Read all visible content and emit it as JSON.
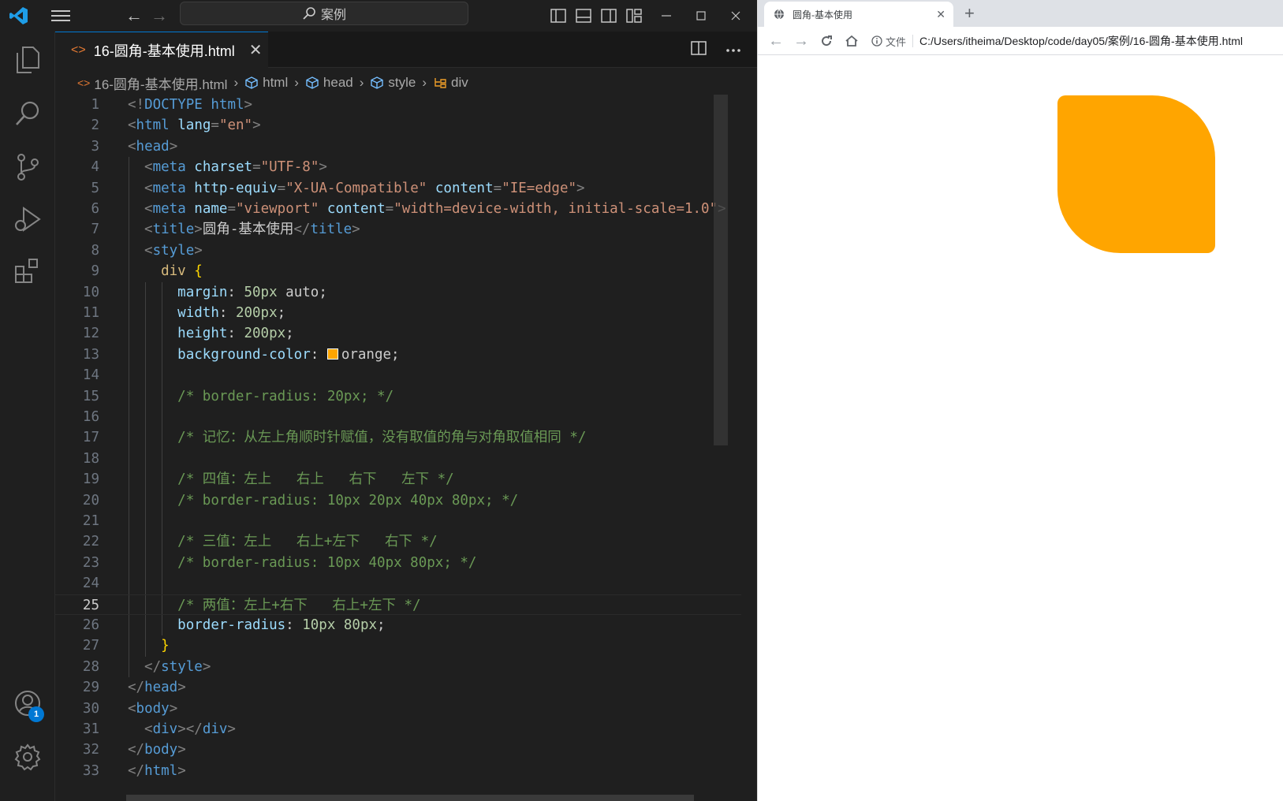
{
  "titlebar": {
    "search_label": "案例"
  },
  "activity": {
    "accounts_badge": "1"
  },
  "tab": {
    "filename": "16-圆角-基本使用.html",
    "close": "✕"
  },
  "breadcrumb": {
    "file": "16-圆角-基本使用.html",
    "items": [
      "html",
      "head",
      "style",
      "div"
    ]
  },
  "editor": {
    "active_line": 25,
    "lines": [
      {
        "n": "1"
      },
      {
        "n": "2"
      },
      {
        "n": "3"
      },
      {
        "n": "4"
      },
      {
        "n": "5"
      },
      {
        "n": "6"
      },
      {
        "n": "7"
      },
      {
        "n": "8"
      },
      {
        "n": "9"
      },
      {
        "n": "10"
      },
      {
        "n": "11"
      },
      {
        "n": "12"
      },
      {
        "n": "13"
      },
      {
        "n": "14"
      },
      {
        "n": "15"
      },
      {
        "n": "16"
      },
      {
        "n": "17"
      },
      {
        "n": "18"
      },
      {
        "n": "19"
      },
      {
        "n": "20"
      },
      {
        "n": "21"
      },
      {
        "n": "22"
      },
      {
        "n": "23"
      },
      {
        "n": "24"
      },
      {
        "n": "25"
      },
      {
        "n": "26"
      },
      {
        "n": "27"
      },
      {
        "n": "28"
      },
      {
        "n": "29"
      },
      {
        "n": "30"
      },
      {
        "n": "31"
      },
      {
        "n": "32"
      },
      {
        "n": "33"
      }
    ],
    "code": {
      "l1": [
        "<!",
        "DOCTYPE",
        " ",
        "html",
        ">"
      ],
      "l2": [
        "<",
        "html",
        " ",
        "lang",
        "=",
        "\"en\"",
        ">"
      ],
      "l3": [
        "<",
        "head",
        ">"
      ],
      "l4": [
        "<",
        "meta",
        " ",
        "charset",
        "=",
        "\"UTF-8\"",
        ">"
      ],
      "l5": [
        "<",
        "meta",
        " ",
        "http-equiv",
        "=",
        "\"X-UA-Compatible\"",
        " ",
        "content",
        "=",
        "\"IE=edge\"",
        ">"
      ],
      "l6": [
        "<",
        "meta",
        " ",
        "name",
        "=",
        "\"viewport\"",
        " ",
        "content",
        "=",
        "\"width=device-width, initial-scale=1.0\"",
        ">"
      ],
      "l7": [
        "<",
        "title",
        ">",
        "圆角-基本使用",
        "</",
        "title",
        ">"
      ],
      "l8": [
        "<",
        "style",
        ">"
      ],
      "l9": [
        "div",
        " ",
        "{"
      ],
      "l10": [
        "margin",
        ": ",
        "50px",
        " ",
        "auto",
        ";"
      ],
      "l11": [
        "width",
        ": ",
        "200px",
        ";"
      ],
      "l12": [
        "height",
        ": ",
        "200px",
        ";"
      ],
      "l13": [
        "background-color",
        ": ",
        "orange",
        ";"
      ],
      "l15": "/* border-radius: 20px; */",
      "l17": "/* 记忆：从左上角顺时针赋值，没有取值的角与对角取值相同 */",
      "l19": "/* 四值：左上   右上   右下   左下 */",
      "l20": "/* border-radius: 10px 20px 40px 80px; */",
      "l22": "/* 三值：左上   右上+左下   右下 */",
      "l23": "/* border-radius: 10px 40px 80px; */",
      "l25": "/* 两值：左上+右下   右上+左下 */",
      "l26": [
        "border-radius",
        ": ",
        "10px 80px",
        ";"
      ],
      "l27": "}",
      "l28": [
        "</",
        "style",
        ">"
      ],
      "l29": [
        "</",
        "head",
        ">"
      ],
      "l30": [
        "<",
        "body",
        ">"
      ],
      "l31": [
        "<",
        "div",
        "></",
        "div",
        ">"
      ],
      "l32": [
        "</",
        "body",
        ">"
      ],
      "l33": [
        "</",
        "html",
        ">"
      ]
    }
  },
  "browser": {
    "tab_title": "圆角-基本使用",
    "tab_close": "✕",
    "new_tab": "+",
    "security_chip": "文件",
    "url": "C:/Users/itheima/Desktop/code/day05/案例/16-圆角-基本使用.html"
  },
  "colors": {
    "accent": "#0078d4",
    "orange": "#ffa500"
  },
  "icons": [
    "vscode-logo-icon",
    "menu-icon",
    "back-icon",
    "forward-icon",
    "search-icon",
    "layout-icons",
    "minimize-icon",
    "maximize-icon",
    "close-icon",
    "explorer-icon",
    "search-icon",
    "source-control-icon",
    "run-debug-icon",
    "extensions-icon",
    "accounts-icon",
    "settings-gear-icon",
    "html-file-icon",
    "split-editor-icon",
    "more-actions-icon",
    "globe-icon",
    "reload-icon",
    "home-icon",
    "info-icon"
  ]
}
